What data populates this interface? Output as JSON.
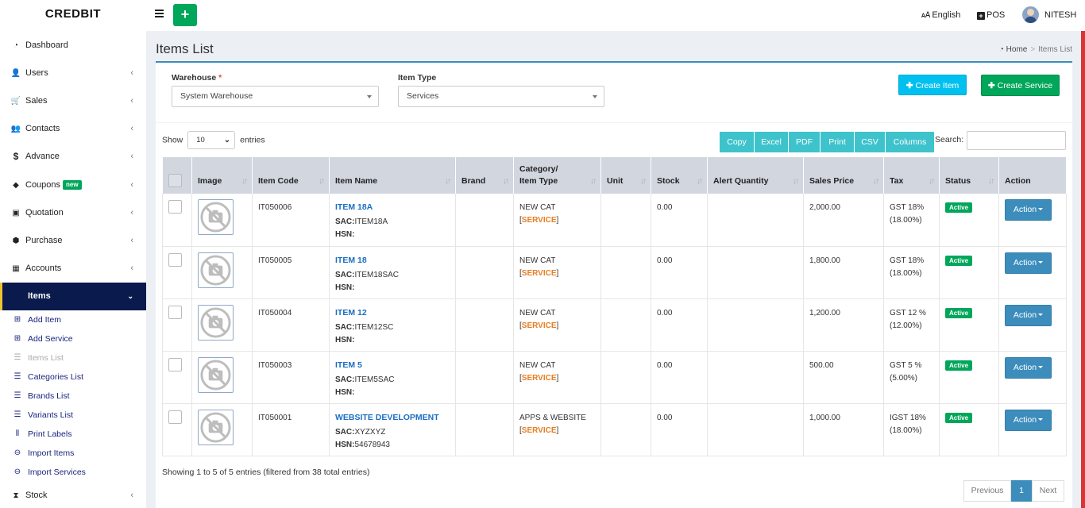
{
  "brand": "CREDBIT",
  "topbar": {
    "language": "English",
    "pos": "POS",
    "user": "NITESH"
  },
  "sidebar": {
    "items": [
      {
        "label": "Dashboard",
        "icon": "dashboard-icon",
        "glyph": "◔"
      },
      {
        "label": "Users",
        "icon": "user-plus-icon",
        "glyph": "👤"
      },
      {
        "label": "Sales",
        "icon": "cart-icon",
        "glyph": "🛒"
      },
      {
        "label": "Contacts",
        "icon": "users-icon",
        "glyph": "👥"
      },
      {
        "label": "Advance",
        "icon": "dollar-icon",
        "glyph": "$"
      },
      {
        "label": "Coupons",
        "icon": "tag-icon",
        "glyph": "◆",
        "badge": "new"
      },
      {
        "label": "Quotation",
        "icon": "calendar-icon",
        "glyph": "▣"
      },
      {
        "label": "Purchase",
        "icon": "cube-icon",
        "glyph": "⬢"
      },
      {
        "label": "Accounts",
        "icon": "grid-icon",
        "glyph": "▦"
      },
      {
        "label": "Items",
        "icon": "",
        "glyph": ""
      }
    ],
    "sub_items": [
      {
        "label": "Add Item",
        "icon": "plus-square-icon",
        "glyph": "⊞"
      },
      {
        "label": "Add Service",
        "icon": "plus-square-icon",
        "glyph": "⊞"
      },
      {
        "label": "Items List",
        "icon": "list-icon",
        "glyph": "☰"
      },
      {
        "label": "Categories List",
        "icon": "list-icon",
        "glyph": "☰"
      },
      {
        "label": "Brands List",
        "icon": "list-icon",
        "glyph": "☰"
      },
      {
        "label": "Variants List",
        "icon": "list-icon",
        "glyph": "☰"
      },
      {
        "label": "Print Labels",
        "icon": "barcode-icon",
        "glyph": "⦀"
      },
      {
        "label": "Import Items",
        "icon": "arrow-circle-icon",
        "glyph": "⊖"
      },
      {
        "label": "Import Services",
        "icon": "arrow-circle-icon",
        "glyph": "⊖"
      }
    ],
    "stock": {
      "label": "Stock",
      "icon": "hourglass-icon",
      "glyph": "⧗"
    }
  },
  "page": {
    "title": "Items List",
    "breadcrumb_home": "Home",
    "breadcrumb_current": "Items List"
  },
  "filters": {
    "warehouse_label": "Warehouse",
    "warehouse_required": "*",
    "warehouse_value": "System Warehouse",
    "item_type_label": "Item Type",
    "item_type_value": "Services",
    "create_item": "Create Item",
    "create_service": "Create Service"
  },
  "table_controls": {
    "show": "Show",
    "length": "10",
    "entries": "entries",
    "exports": [
      "Copy",
      "Excel",
      "PDF",
      "Print",
      "CSV",
      "Columns"
    ],
    "search_label": "Search:"
  },
  "table": {
    "headers": [
      "",
      "Image",
      "Item Code",
      "Item Name",
      "Brand",
      "Category/ Item Type",
      "Unit",
      "Stock",
      "Alert Quantity",
      "Sales Price",
      "Tax",
      "Status",
      "Action"
    ],
    "header_category_line1": "Category/",
    "header_category_line2": "Item Type",
    "rows": [
      {
        "code": "IT050006",
        "name": "ITEM 18A",
        "sac_label": "SAC:",
        "sac": "ITEM18A",
        "hsn_label": "HSN:",
        "hsn": "",
        "category": "NEW CAT",
        "type": "SERVICE",
        "stock": "0.00",
        "price": "2,000.00",
        "tax_name": "GST 18%",
        "tax_rate": "(18.00%)",
        "status": "Active",
        "action": "Action"
      },
      {
        "code": "IT050005",
        "name": "ITEM 18",
        "sac_label": "SAC:",
        "sac": "ITEM18SAC",
        "hsn_label": "HSN:",
        "hsn": "",
        "category": "NEW CAT",
        "type": "SERVICE",
        "stock": "0.00",
        "price": "1,800.00",
        "tax_name": "GST 18%",
        "tax_rate": "(18.00%)",
        "status": "Active",
        "action": "Action"
      },
      {
        "code": "IT050004",
        "name": "ITEM 12",
        "sac_label": "SAC:",
        "sac": "ITEM12SC",
        "hsn_label": "HSN:",
        "hsn": "",
        "category": "NEW CAT",
        "type": "SERVICE",
        "stock": "0.00",
        "price": "1,200.00",
        "tax_name": "GST 12 %",
        "tax_rate": "(12.00%)",
        "status": "Active",
        "action": "Action"
      },
      {
        "code": "IT050003",
        "name": "ITEM 5",
        "sac_label": "SAC:",
        "sac": "ITEM5SAC",
        "hsn_label": "HSN:",
        "hsn": "",
        "category": "NEW CAT",
        "type": "SERVICE",
        "stock": "0.00",
        "price": "500.00",
        "tax_name": "GST 5 %",
        "tax_rate": "(5.00%)",
        "status": "Active",
        "action": "Action"
      },
      {
        "code": "IT050001",
        "name": "WEBSITE DEVELOPMENT",
        "sac_label": "SAC:",
        "sac": "XYZXYZ",
        "hsn_label": "HSN:",
        "hsn": "54678943",
        "category": "APPS & WEBSITE",
        "type": "SERVICE",
        "stock": "0.00",
        "price": "1,000.00",
        "tax_name": "IGST 18%",
        "tax_rate": "(18.00%)",
        "status": "Active",
        "action": "Action"
      }
    ]
  },
  "footer": {
    "info": "Showing 1 to 5 of 5 entries (filtered from 38 total entries)",
    "previous": "Previous",
    "page": "1",
    "next": "Next"
  },
  "colors": {
    "sidebar_active": "#0b1a4c",
    "primary": "#3c8dbc",
    "success": "#00a65a",
    "info": "#00c0ef",
    "export": "#3ec3cc",
    "service_text": "#e67e22"
  }
}
